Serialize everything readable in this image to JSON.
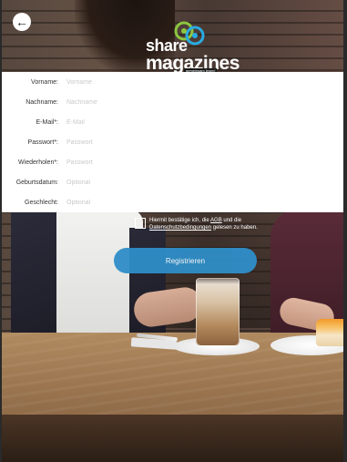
{
  "header": {
    "back_glyph": "←",
    "logo_line1": "share",
    "logo_line2": "magazines",
    "logo_tagline": "gemeinsam lesen!"
  },
  "form": {
    "fields": [
      {
        "label": "Vorname:",
        "placeholder": "Vorname"
      },
      {
        "label": "Nachname:",
        "placeholder": "Nachname"
      },
      {
        "label": "E-Mail*:",
        "placeholder": "E-Mail"
      },
      {
        "label": "Passwort*:",
        "placeholder": "Passwort"
      },
      {
        "label": "Wiederholen*:",
        "placeholder": "Passwort"
      },
      {
        "label": "Geburtsdatum:",
        "placeholder": "Optional"
      },
      {
        "label": "Geschlecht:",
        "placeholder": "Optional"
      }
    ]
  },
  "consent": {
    "text_part1": "Hiermit bestätige ich, die ",
    "agb": "AGB",
    "text_part2": " und die ",
    "privacy": "Datenschutzbedingungen",
    "text_part3": " gelesen zu haben."
  },
  "register": {
    "label": "Registrieren"
  },
  "colors": {
    "accent": "#2f8ec8",
    "logo_green": "#8cc63f",
    "logo_blue": "#29abe2"
  }
}
